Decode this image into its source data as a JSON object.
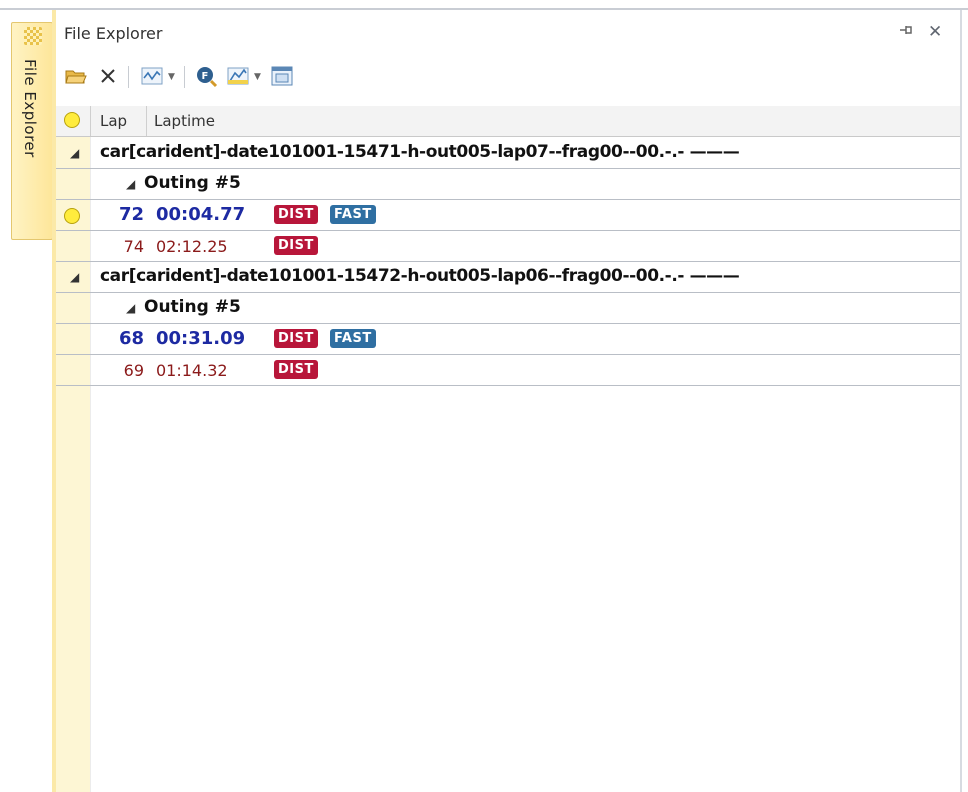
{
  "dock_tab": {
    "label": "File Explorer"
  },
  "panel": {
    "title": "File Explorer",
    "pin_glyph": "⊣⊢",
    "close_glyph": "✕"
  },
  "toolbar": {
    "icons": [
      "open-folder-icon",
      "delete-icon",
      "chart-icon",
      "search-icon",
      "graph-icon",
      "table-icon"
    ]
  },
  "grid": {
    "columns": [
      "Lap",
      "Laptime"
    ],
    "files": [
      {
        "name": "car[carident]-date101001-15471-h-out005-lap07--frag00--00.-.- ———",
        "outing": "Outing #5",
        "laps": [
          {
            "lap": "72",
            "time": "00:04.77",
            "best": true,
            "badges": [
              "DIST",
              "FAST"
            ]
          },
          {
            "lap": "74",
            "time": "02:12.25",
            "best": false,
            "badges": [
              "DIST"
            ]
          }
        ]
      },
      {
        "name": "car[carident]-date101001-15472-h-out005-lap06--frag00--00.-.- ———",
        "outing": "Outing #5",
        "laps": [
          {
            "lap": "68",
            "time": "00:31.09",
            "best": true,
            "badges": [
              "DIST",
              "FAST"
            ]
          },
          {
            "lap": "69",
            "time": "01:14.32",
            "best": false,
            "badges": [
              "DIST"
            ]
          }
        ]
      }
    ]
  },
  "colors": {
    "best_lap_text": "#1d2aa2",
    "normal_lap_text": "#8b1a1a",
    "dist_badge": "#b8163a",
    "fast_badge": "#2f6fa2",
    "indicator": "#ffec3d"
  }
}
